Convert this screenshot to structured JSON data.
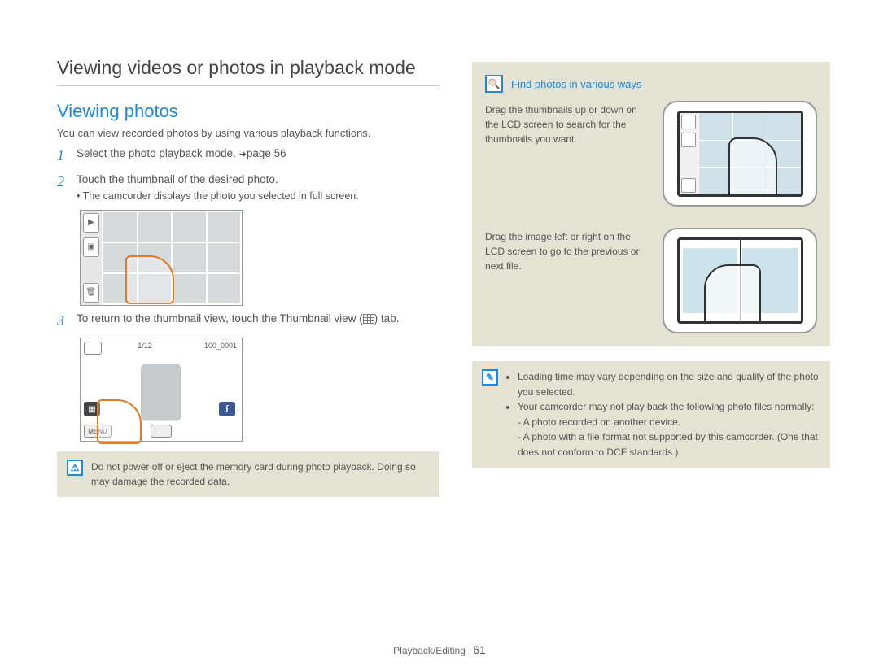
{
  "page_title": "Viewing videos or photos in playback mode",
  "section_title": "Viewing photos",
  "intro": "You can view recorded photos by using various playback functions.",
  "steps": [
    {
      "num": "1",
      "text": "Select the photo playback mode. ",
      "page_ref": "page 56"
    },
    {
      "num": "2",
      "text": "Touch the thumbnail of the desired photo.",
      "sub": "The camcorder displays the photo you selected in full screen."
    },
    {
      "num": "3",
      "text_a": "To return to the thumbnail view, touch the Thumbnail view (",
      "text_b": ") tab."
    }
  ],
  "illus2_topbar": {
    "counter": "1/12",
    "fileno": "100_0001"
  },
  "illus2_menu_label": "MENU",
  "warning_note": "Do not power off or eject the memory card during photo playback. Doing so may damage the recorded data.",
  "tip_title": "Find photos in various ways",
  "tip_rows": [
    "Drag the thumbnails up or down on the LCD screen to search for the thumbnails you want.",
    "Drag the image left or right on the LCD screen to go to the previous or next file."
  ],
  "info_bullets": {
    "b1": "Loading time may vary depending on the size and quality of the photo you selected.",
    "b2": "Your camcorder may not play back the following photo files normally:",
    "b2a": "A photo recorded on another device.",
    "b2b": "A photo with a file format not supported by this camcorder. (One that does not conform to DCF standards.)"
  },
  "footer": {
    "section": "Playback/Editing",
    "page": "61"
  }
}
